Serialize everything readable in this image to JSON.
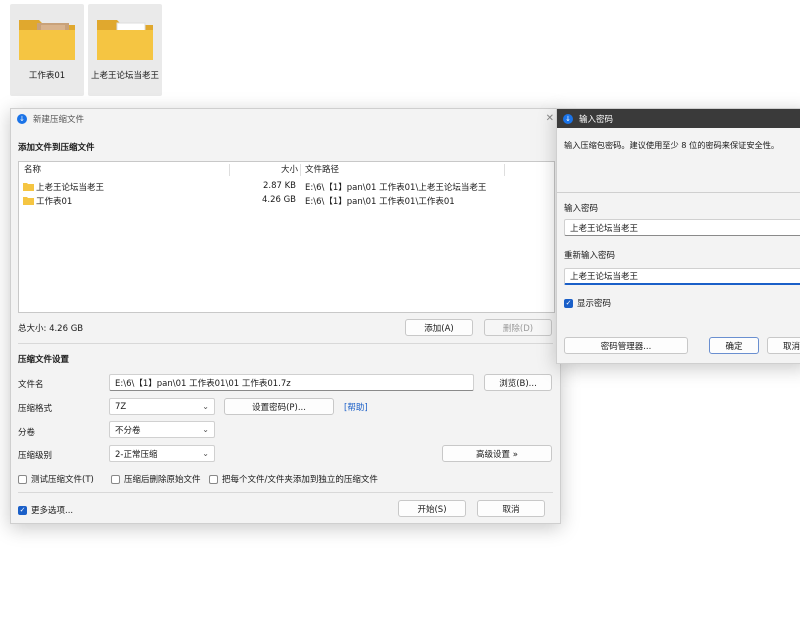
{
  "desktop": {
    "items": [
      {
        "label": "工作表01"
      },
      {
        "label": "上老王论坛当老王"
      }
    ]
  },
  "archive_dialog": {
    "title": "新建压缩文件",
    "add_section_title": "添加文件到压缩文件",
    "columns": {
      "name": "名称",
      "size": "大小",
      "path": "文件路径"
    },
    "files": [
      {
        "name": "上老王论坛当老王",
        "size": "2.87 KB",
        "path": "E:\\6\\【1】pan\\01 工作表01\\上老王论坛当老王"
      },
      {
        "name": "工作表01",
        "size": "4.26 GB",
        "path": "E:\\6\\【1】pan\\01 工作表01\\工作表01"
      }
    ],
    "total_size": "总大小: 4.26 GB",
    "add_button": "添加(A)",
    "delete_button": "删除(D)",
    "settings_title": "压缩文件设置",
    "filename_label": "文件名",
    "filename_value": "E:\\6\\【1】pan\\01 工作表01\\01 工作表01.7z",
    "browse_button": "浏览(B)...",
    "format_label": "压缩格式",
    "format_value": "7Z",
    "set_password_button": "设置密码(P)...",
    "help_link": "[帮助]",
    "split_label": "分卷",
    "split_value": "不分卷",
    "level_label": "压缩级别",
    "level_value": "2-正常压缩",
    "advanced_button": "高级设置 »",
    "opt_test": "测试压缩文件(T)",
    "opt_delete_source": "压缩后删除原始文件",
    "opt_separate": "把每个文件/文件夹添加到独立的压缩文件",
    "more_options": "更多选项...",
    "start_button": "开始(S)",
    "cancel_button": "取消"
  },
  "password_dialog": {
    "title": "输入密码",
    "description": "输入压缩包密码。建议使用至少 8 位的密码来保证安全性。",
    "password_label": "输入密码",
    "password_value": "上老王论坛当老王",
    "confirm_label": "重新输入密码",
    "confirm_value": "上老王论坛当老王",
    "show_password": "显示密码",
    "manager_button": "密码管理器...",
    "ok_button": "确定",
    "cancel_button": "取消"
  },
  "colors": {
    "accent": "#1a5fc8",
    "folder": "#f5c542"
  }
}
